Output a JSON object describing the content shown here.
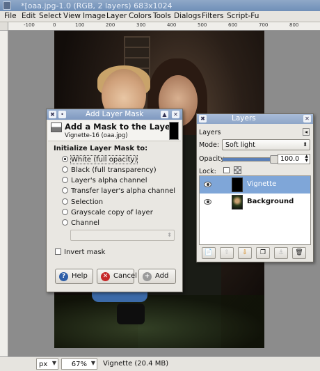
{
  "window": {
    "title": "*[oaa.jpg-1.0 (RGB, 2 layers) 683x1024"
  },
  "menubar": {
    "items": [
      "File",
      "Edit",
      "Select",
      "View",
      "Image",
      "Layer",
      "Colors",
      "Tools",
      "Dialogs",
      "Filters",
      "Script-Fu"
    ]
  },
  "ruler": {
    "labels": [
      "-100",
      "0",
      "100",
      "200",
      "300",
      "400",
      "500",
      "600",
      "700",
      "800"
    ]
  },
  "statusbar": {
    "unit": "px",
    "zoom": "67%",
    "status": "Vignette (20.4 MB)"
  },
  "dialog": {
    "title": "Add Layer Mask",
    "heading": "Add a Mask to the Layer",
    "subheading": "Vignette-16 (oaa.jpg)",
    "section_label": "Initialize Layer Mask to:",
    "options": [
      "White (full opacity)",
      "Black (full transparency)",
      "Layer's alpha channel",
      "Transfer layer's alpha channel",
      "Selection",
      "Grayscale copy of layer",
      "Channel"
    ],
    "selected_option": 0,
    "invert_label": "Invert mask",
    "help_label": "Help",
    "cancel_label": "Cancel",
    "add_label": "Add"
  },
  "layers_panel": {
    "title": "Layers",
    "tab_label": "Layers",
    "mode_label": "Mode:",
    "mode_value": "Soft light",
    "opacity_label": "Opacity:",
    "opacity_value": "100.0",
    "opacity": 1.0,
    "lock_label": "Lock:",
    "layers": [
      {
        "name": "Vignette",
        "active": true
      },
      {
        "name": "Background",
        "active": false
      }
    ]
  },
  "colors": {
    "accent": "#7fa6d8",
    "dialog_bg": "#e9e7e2",
    "titlebar": "#7f99c0"
  }
}
